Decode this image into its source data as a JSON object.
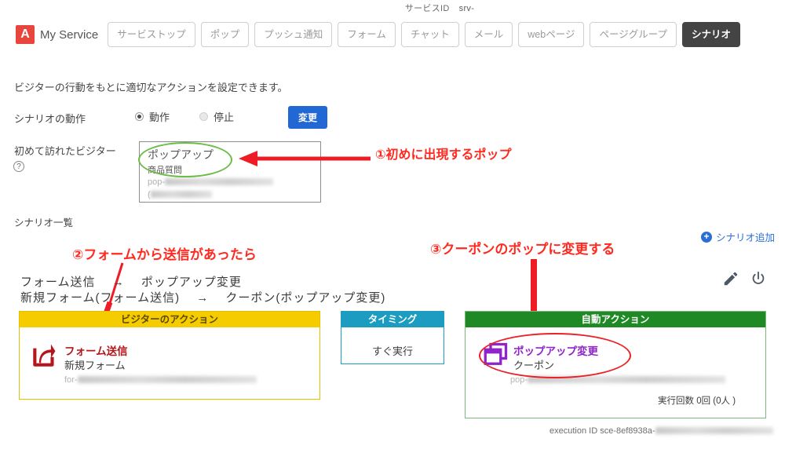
{
  "header": {
    "service_id_label": "サービスID",
    "service_id_value": "srv-",
    "logo_letter": "A",
    "brand": "My Service",
    "nav": [
      {
        "label": "サービストップ",
        "active": false
      },
      {
        "label": "ポップ",
        "active": false
      },
      {
        "label": "プッシュ通知",
        "active": false
      },
      {
        "label": "フォーム",
        "active": false
      },
      {
        "label": "チャット",
        "active": false
      },
      {
        "label": "メール",
        "active": false
      },
      {
        "label": "webページ",
        "active": false
      },
      {
        "label": "ページグループ",
        "active": false
      },
      {
        "label": "シナリオ",
        "active": true
      }
    ]
  },
  "description": "ビジターの行動をもとに適切なアクションを設定できます。",
  "operation": {
    "label": "シナリオの動作",
    "options": [
      {
        "label": "動作",
        "selected": true
      },
      {
        "label": "停止",
        "selected": false
      }
    ],
    "change_button": "変更"
  },
  "first_visitor": {
    "label": "初めて訪れたビジター",
    "help_icon": "question-mark",
    "popup_title": "ポップアップ",
    "popup_sub": "商品質問",
    "popup_id_prefix": "pop-",
    "popup_id_prefix2": "("
  },
  "scenario_list": {
    "label": "シナリオ一覧",
    "add_label": "シナリオ追加",
    "title_line1": "フォーム送信 　→ 　ポップアップ変更",
    "title_line2": "新規フォーム(フォーム送信) 　→ 　クーポン(ポップアップ変更)",
    "edit_icon": "pencil-icon",
    "power_icon": "power-icon"
  },
  "cards": {
    "visitor": {
      "head": "ビジターのアクション",
      "icon": "share-export-icon",
      "action_name": "フォーム送信",
      "action_sub": "新規フォーム",
      "action_id_prefix": "for-"
    },
    "timing": {
      "head": "タイミング",
      "body": "すぐ実行"
    },
    "auto": {
      "head": "自動アクション",
      "icon": "windows-stack-icon",
      "action_name": "ポップアップ変更",
      "action_sub": "クーポン",
      "action_id_prefix": "pop-",
      "exec_count": "実行回数 0回 (0人 )"
    },
    "execution_id": "execution ID sce-8ef8938a-"
  },
  "annotations": {
    "one": "①初めに出現するポップ",
    "two": "②フォームから送信があったら",
    "three": "③クーポンのポップに変更する"
  },
  "colors": {
    "accent_red": "#e8453c",
    "annotation_red": "#ff2a1f",
    "yellow": "#f5cc00",
    "teal": "#1c9cc0",
    "green": "#1f8a25",
    "purple": "#8e24c9",
    "blue": "#2268d4",
    "green_circle": "#6abd45"
  }
}
